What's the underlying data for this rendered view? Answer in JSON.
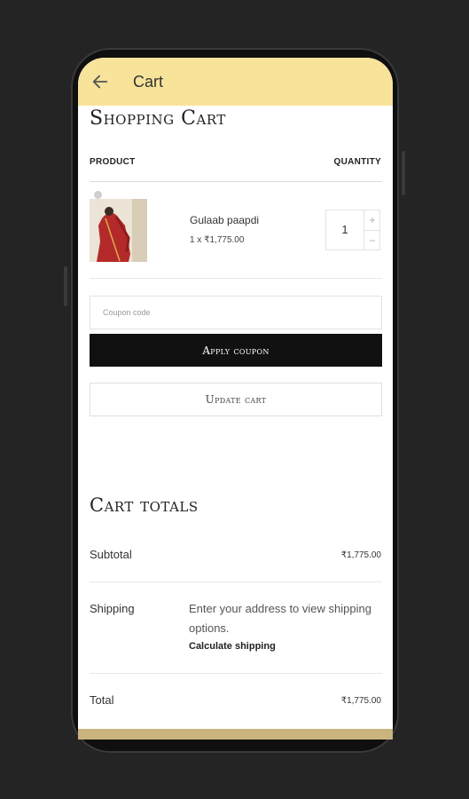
{
  "appbar": {
    "title": "Cart"
  },
  "cart": {
    "heading": "Shopping Cart",
    "columns": {
      "product": "PRODUCT",
      "quantity": "QUANTITY"
    },
    "item": {
      "name": "Gulaab paapdi",
      "price_line": "1 x ₹1,775.00",
      "quantity": "1"
    },
    "qty_plus": "+",
    "qty_minus": "−"
  },
  "coupon": {
    "placeholder": "Coupon code",
    "apply_label": "Apply coupon"
  },
  "update_label": "Update cart",
  "totals": {
    "heading": "Cart totals",
    "subtotal_label": "Subtotal",
    "subtotal_value": "₹1,775.00",
    "shipping_label": "Shipping",
    "shipping_text": "Enter your address to view shipping options.",
    "calculate_label": "Calculate shipping",
    "total_label": "Total",
    "total_value": "₹1,775.00"
  },
  "colors": {
    "appbar": "#f8e39a",
    "button_dark": "#111111",
    "accent_strip": "#c9b47e"
  },
  "icons": {
    "back": "arrow-left-icon"
  }
}
